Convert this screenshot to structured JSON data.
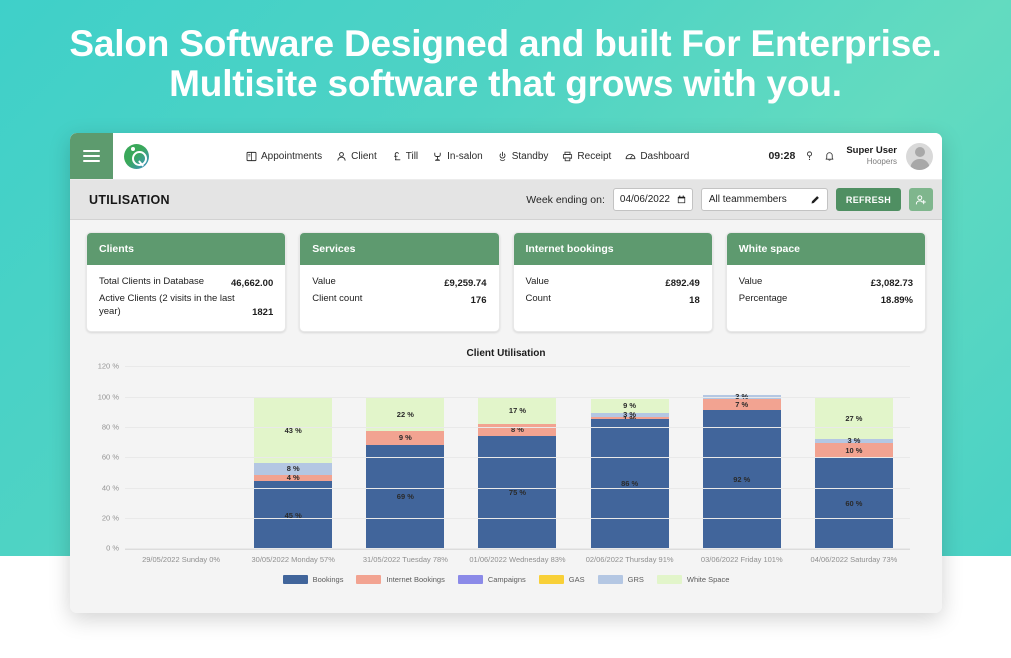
{
  "hero": {
    "line1": "Salon Software Designed and built For Enterprise.",
    "line2": "Multisite software that grows with you."
  },
  "navbar": {
    "menu_label": "menu",
    "items": [
      {
        "label": "Appointments",
        "icon": "calendar-icon"
      },
      {
        "label": "Client",
        "icon": "person-icon"
      },
      {
        "label": "Till",
        "icon": "pound-icon"
      },
      {
        "label": "In-salon",
        "icon": "chair-icon"
      },
      {
        "label": "Standby",
        "icon": "standby-icon"
      },
      {
        "label": "Receipt",
        "icon": "printer-icon"
      },
      {
        "label": "Dashboard",
        "icon": "gauge-icon"
      }
    ],
    "clock": "09:28",
    "help_icon": "help-icon",
    "bell_icon": "bell-icon",
    "user_name": "Super User",
    "user_org": "Hoopers"
  },
  "toolbar": {
    "page_title": "UTILISATION",
    "week_label": "Week ending on:",
    "date_value": "04/06/2022",
    "team_value": "All teammembers",
    "refresh_label": "REFRESH",
    "add_user_icon": "add-user-icon",
    "calendar_icon": "calendar-icon",
    "edit_icon": "pencil-icon"
  },
  "cards": [
    {
      "title": "Clients",
      "rows": [
        {
          "label": "Total Clients in Database",
          "value": "46,662.00"
        },
        {
          "label": "Active Clients (2 visits in the last year)",
          "value": "1821"
        }
      ]
    },
    {
      "title": "Services",
      "rows": [
        {
          "label": "Value",
          "value": "£9,259.74"
        },
        {
          "label": "Client count",
          "value": "176"
        }
      ]
    },
    {
      "title": "Internet bookings",
      "rows": [
        {
          "label": "Value",
          "value": "£892.49"
        },
        {
          "label": "Count",
          "value": "18"
        }
      ]
    },
    {
      "title": "White space",
      "rows": [
        {
          "label": "Value",
          "value": "£3,082.73"
        },
        {
          "label": "Percentage",
          "value": "18.89%"
        }
      ]
    }
  ],
  "chart_data": {
    "type": "bar",
    "stacked": true,
    "title": "Client Utilisation",
    "xlabel": "",
    "ylabel": "",
    "ylim": [
      0,
      120
    ],
    "yticks": [
      "0 %",
      "20 %",
      "40 %",
      "60 %",
      "80 %",
      "100 %",
      "120 %"
    ],
    "grid": true,
    "legend_position": "bottom",
    "categories": [
      "29/05/2022 Sunday 0%",
      "30/05/2022 Monday 57%",
      "31/05/2022 Tuesday 78%",
      "01/06/2022 Wednesday 83%",
      "02/06/2022 Thursday 91%",
      "03/06/2022 Friday 101%",
      "04/06/2022 Saturday 73%"
    ],
    "series": [
      {
        "name": "Bookings",
        "color": "#41659b",
        "values": [
          0,
          45,
          69,
          75,
          86,
          92,
          60
        ]
      },
      {
        "name": "Internet Bookings",
        "color": "#f2a391",
        "values": [
          0,
          4,
          9,
          8,
          1,
          7,
          10
        ]
      },
      {
        "name": "Campaigns",
        "color": "#8b8ae8",
        "values": [
          0,
          0,
          0,
          0,
          0,
          0,
          0
        ]
      },
      {
        "name": "GAS",
        "color": "#f8d038",
        "values": [
          0,
          0,
          0,
          0,
          0,
          0,
          0
        ]
      },
      {
        "name": "GRS",
        "color": "#b4c7e3",
        "values": [
          0,
          8,
          0,
          0,
          3,
          3,
          3
        ]
      },
      {
        "name": "White Space",
        "color": "#e2f5ca",
        "values": [
          0,
          43,
          22,
          17,
          9,
          0,
          27
        ]
      }
    ],
    "bar_labels": [
      [],
      [
        "45 %",
        "4 %",
        "8 %",
        "43 %"
      ],
      [
        "69 %",
        "9 %",
        "22 %"
      ],
      [
        "75 %",
        "8 %",
        "17 %"
      ],
      [
        "86 %",
        "1 %",
        "3 %",
        "9 %"
      ],
      [
        "92 %",
        "7 %",
        "3 %"
      ],
      [
        "60 %",
        "10 %",
        "3 %",
        "27 %"
      ]
    ]
  },
  "colors": {
    "accent_green": "#5e9a6f",
    "button_green": "#4f8f62",
    "page_bg": "#f4f4f4",
    "hero_bg": "#45cfc6"
  }
}
